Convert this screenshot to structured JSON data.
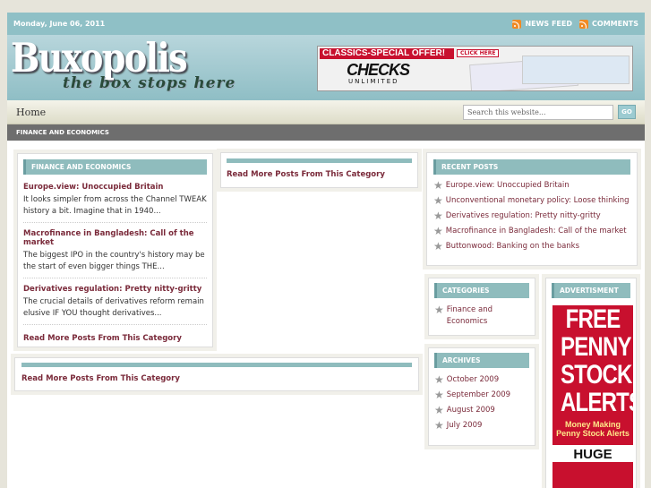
{
  "topbar": {
    "date": "Monday, June 06, 2011",
    "news_feed": "NEWS FEED",
    "comments": "COMMENTS"
  },
  "header": {
    "logo": "Buxopolis",
    "tagline": "the box stops here",
    "banner": {
      "offer": "CLASSICS-SPECIAL OFFER!",
      "click": "CLICK HERE",
      "brand": "CHECKS",
      "brand_sub": "UNLIMITED"
    }
  },
  "nav": {
    "home": "Home",
    "search_placeholder": "Search this website...",
    "go": "GO"
  },
  "category_bar": "FINANCE AND ECONOMICS",
  "left": {
    "title": "FINANCE AND ECONOMICS",
    "posts": [
      {
        "title": "Europe.view: Unoccupied Britain",
        "excerpt": "It looks simpler from across the Channel TWEAK history a bit. Imagine that in 1940..."
      },
      {
        "title": "Macrofinance in Bangladesh: Call of the market",
        "excerpt": "The biggest IPO in the country's history may be the start of even bigger things THE..."
      },
      {
        "title": "Derivatives regulation: Pretty nitty-gritty",
        "excerpt": "The crucial details of derivatives reform remain elusive IF YOU thought derivatives..."
      }
    ],
    "more": "Read More Posts From This Category"
  },
  "middle": {
    "more": "Read More Posts From This Category"
  },
  "bottom": {
    "more": "Read More Posts From This Category"
  },
  "recent": {
    "title": "RECENT POSTS",
    "items": [
      "Europe.view: Unoccupied Britain",
      "Unconventional monetary policy: Loose thinking",
      "Derivatives regulation: Pretty nitty-gritty",
      "Macrofinance in Bangladesh: Call of the market",
      "Buttonwood: Banking on the banks"
    ]
  },
  "categories": {
    "title": "CATEGORIES",
    "items": [
      "Finance and Economics"
    ]
  },
  "archives": {
    "title": "ARCHIVES",
    "items": [
      "October 2009",
      "September 2009",
      "August 2009",
      "July 2009"
    ]
  },
  "advert": {
    "title": "ADVERTISMENT",
    "lines": [
      "FREE",
      "PENNY",
      "STOCK",
      "ALERTS!"
    ],
    "money": "Money Making Penny Stock Alerts",
    "huge": "HUGE"
  }
}
